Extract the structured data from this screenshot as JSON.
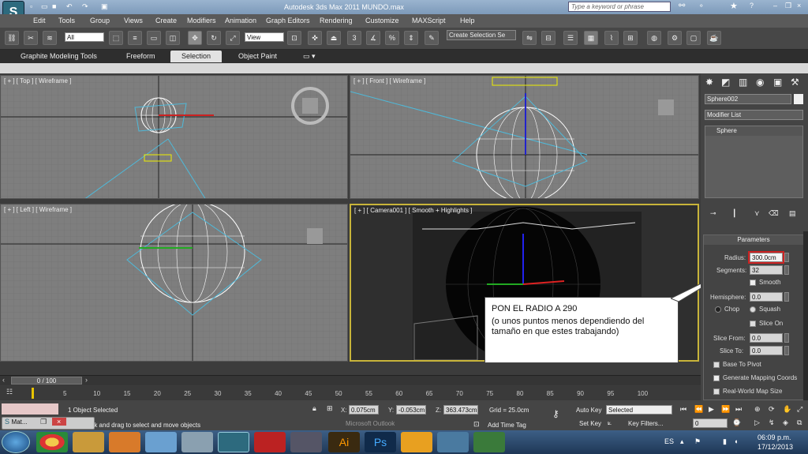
{
  "window": {
    "title": "Autodesk 3ds Max  2011    MUNDO.max",
    "search_placeholder": "Type a keyword or phrase"
  },
  "menu": [
    "Edit",
    "Tools",
    "Group",
    "Views",
    "Create",
    "Modifiers",
    "Animation",
    "Graph Editors",
    "Rendering",
    "Customize",
    "MAXScript",
    "Help"
  ],
  "toolbar": {
    "filter_value": "All",
    "view_value": "View",
    "selection_set_value": "Create Selection Se"
  },
  "ribbon_tabs": [
    "Graphite Modeling Tools",
    "Freeform",
    "Selection",
    "Object Paint"
  ],
  "ribbon_active": "Selection",
  "viewports": {
    "top_label": "[ + ] [ Top ] [ Wireframe ]",
    "front_label": "[ + ] [ Front ] [ Wireframe ]",
    "left_label": "[ + ] [ Left ] [ Wireframe ]",
    "camera_label": "[ + ] [ Camera001 ] [ Smooth + Highlights ]"
  },
  "callout": {
    "line1": "PON EL RADIO A 290",
    "line2": "(o unos puntos menos dependiendo del tamaño en que estes trabajando)"
  },
  "command_panel": {
    "object_name": "Sphere002",
    "modifier_list": "Modifier List",
    "stack_item": "Sphere",
    "rollout_title": "Parameters",
    "radius_label": "Radius:",
    "radius_value": "300.0cm",
    "segments_label": "Segments:",
    "segments_value": "32",
    "smooth_label": "Smooth",
    "hemisphere_label": "Hemisphere:",
    "hemisphere_value": "0.0",
    "chop_label": "Chop",
    "squash_label": "Squash",
    "slice_on_label": "Slice On",
    "slice_from_label": "Slice From:",
    "slice_from_value": "0.0",
    "slice_to_label": "Slice To:",
    "slice_to_value": "0.0",
    "base_to_pivot_label": "Base To Pivot",
    "gen_mapping_label": "Generate Mapping Coords",
    "real_world_label": "Real-World Map Size"
  },
  "timeline": {
    "frame_readout": "0 / 100",
    "ticks": [
      "5",
      "10",
      "15",
      "20",
      "25",
      "30",
      "35",
      "40",
      "45",
      "50",
      "55",
      "60",
      "65",
      "70",
      "75",
      "80",
      "85",
      "90",
      "95",
      "100"
    ]
  },
  "status": {
    "selected": "1 Object Selected",
    "prompt": "Click and drag to select and move objects",
    "x_label": "X:",
    "x_value": "0.075cm",
    "y_label": "Y:",
    "y_value": "-0.053cm",
    "z_label": "Z:",
    "z_value": "363.473cm",
    "grid": "Grid = 25.0cm",
    "add_time_tag": "Add Time Tag",
    "autokey": "Auto Key",
    "autokey_value": "Selected",
    "setkey": "Set Key",
    "key_filters": "Key Filters...",
    "frame_value": "0",
    "mat_tab": "Mat...",
    "outlook_hint": "Microsoft Outlook"
  },
  "taskbar": {
    "language": "ES",
    "time": "06:09 p.m.",
    "date": "17/12/2013"
  },
  "colors": {
    "viewport_bg": "#808080",
    "wire_white": "#ffffff",
    "camera_cyan": "#4fb9d9",
    "highlight_red": "#cc2222",
    "camera_border": "#c8b43a"
  }
}
